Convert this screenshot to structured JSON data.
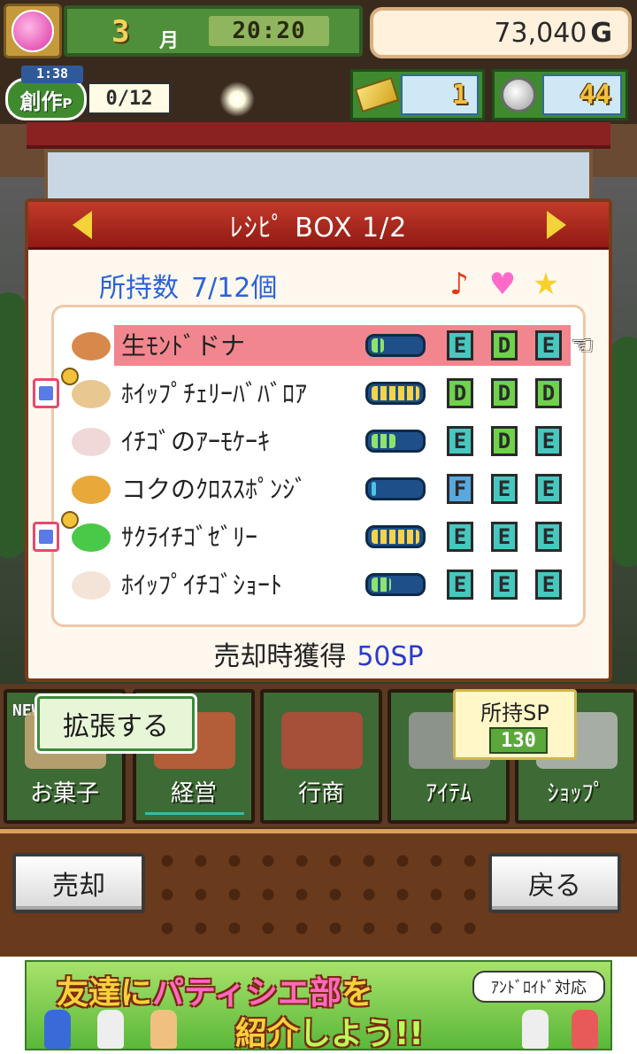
{
  "hud": {
    "month": "3",
    "month_unit": "月",
    "time": "20:20",
    "money": "73,040",
    "money_unit": "G",
    "create_timer": "1:38",
    "create_label": "創作",
    "create_label_sub": "P",
    "create_count": "0/12",
    "tickets": "1",
    "coins": "44"
  },
  "panel": {
    "title": "ﾚｼﾋﾟ BOX  1/2",
    "owned_label": "所持数",
    "owned_value": "7/12個",
    "attr_icons": [
      "music-note",
      "heart",
      "star"
    ],
    "rows": [
      {
        "name": "生ﾓﾝﾄﾞドナ",
        "gauge": 0.25,
        "gauge_color": "green",
        "grades": [
          "E",
          "D",
          "E"
        ],
        "selected": true,
        "badge": false,
        "food_color": "#d8884a"
      },
      {
        "name": "ﾎｲｯﾌﾟﾁｪﾘｰﾊﾞﾊﾞﾛｱ",
        "gauge": 1.0,
        "gauge_color": "yellow",
        "grades": [
          "D",
          "D",
          "D"
        ],
        "selected": false,
        "badge": true,
        "food_color": "#e8c890"
      },
      {
        "name": "ｲﾁｺﾞのｱｰﾓｹｰｷ",
        "gauge": 0.5,
        "gauge_color": "green",
        "grades": [
          "E",
          "D",
          "E"
        ],
        "selected": false,
        "badge": false,
        "food_color": "#f0d8d8"
      },
      {
        "name": "コクのｸﾛｽｽﾎﾟﾝｼﾞ",
        "gauge": 0.1,
        "gauge_color": "cyan",
        "grades": [
          "F",
          "E",
          "E"
        ],
        "selected": false,
        "badge": false,
        "food_color": "#e8a83a"
      },
      {
        "name": "ｻｸﾗｲﾁｺﾞｾﾞﾘｰ",
        "gauge": 1.0,
        "gauge_color": "yellow",
        "grades": [
          "E",
          "E",
          "E"
        ],
        "selected": false,
        "badge": true,
        "food_color": "#4ac848"
      },
      {
        "name": "ﾎｲｯﾌﾟｲﾁｺﾞｼｮｰﾄ",
        "gauge": 0.4,
        "gauge_color": "green",
        "grades": [
          "E",
          "E",
          "E"
        ],
        "selected": false,
        "badge": false,
        "food_color": "#f4e4d8"
      }
    ],
    "sell_gain_label": "売却時獲得",
    "sell_gain_value": "50SP"
  },
  "menu": {
    "new_tag": "NEW",
    "expand_label": "拡張する",
    "items": [
      {
        "label": "お菓子",
        "icon": "sweets-icon",
        "color": "#c8a878"
      },
      {
        "label": "経営",
        "icon": "shop-building-icon",
        "color": "#c85a3a"
      },
      {
        "label": "行商",
        "icon": "food-truck-icon",
        "color": "#b84a3a"
      },
      {
        "label": "ｱｲﾃﾑ",
        "icon": "gear-icon",
        "color": "#9a9a9a"
      },
      {
        "label": "ｼｮｯﾌﾟ",
        "icon": "cart-icon",
        "color": "#b8b8b8"
      }
    ],
    "sp_label": "所持SP",
    "sp_value": "130"
  },
  "actions": {
    "sell_label": "売却",
    "back_label": "戻る"
  },
  "ad": {
    "line1_a": "友達に",
    "line1_b": "パティシエ部",
    "line1_c": "を",
    "line2_a": "紹介",
    "line2_b": "しよう!!",
    "tag": "ｱﾝﾄﾞﾛｲﾄﾞ対応"
  }
}
